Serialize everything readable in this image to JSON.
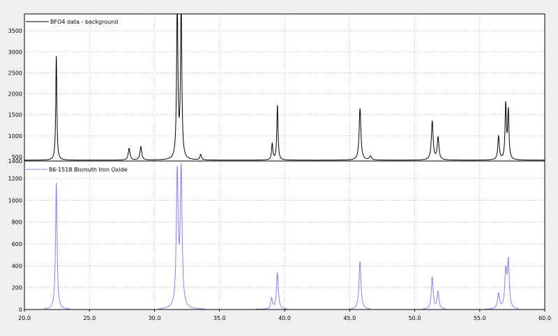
{
  "colors": {
    "background": "#f0f0f0",
    "plot_background": "#ffffff",
    "axis": "#000000",
    "grid": "#b4b4b4",
    "series_top": "#000000",
    "series_bottom": "#8080ff",
    "legend_bottom_text": "#8080ff"
  },
  "chart_data": [
    {
      "type": "line",
      "panel": "top",
      "grid": true,
      "legend_position": "top-left",
      "xlim": [
        20.0,
        60.0
      ],
      "ylim": [
        400,
        3900
      ],
      "y_tick_labels": [
        "400",
        "500",
        "1000",
        "1500",
        "2000",
        "2500",
        "3000",
        "3500"
      ],
      "y_tick_values": [
        400,
        500,
        1000,
        1500,
        2000,
        2500,
        3000,
        3500
      ],
      "y_tick_label_display": [
        "1400",
        "500",
        "1000",
        "1500",
        "2000",
        "2500",
        "3000",
        "3500"
      ],
      "series": [
        {
          "name": "BFO4 data - background",
          "color": "#000000",
          "baseline": 420,
          "peaks": [
            {
              "x": 22.45,
              "y": 2480,
              "w": 0.05
            },
            {
              "x": 28.05,
              "y": 280,
              "w": 0.08
            },
            {
              "x": 28.95,
              "y": 320,
              "w": 0.08
            },
            {
              "x": 31.75,
              "y": 3700,
              "w": 0.06
            },
            {
              "x": 32.05,
              "y": 3700,
              "w": 0.06
            },
            {
              "x": 33.55,
              "y": 130,
              "w": 0.07
            },
            {
              "x": 39.05,
              "y": 380,
              "w": 0.06
            },
            {
              "x": 39.45,
              "y": 1300,
              "w": 0.055
            },
            {
              "x": 45.8,
              "y": 1230,
              "w": 0.08
            },
            {
              "x": 46.6,
              "y": 90,
              "w": 0.1
            },
            {
              "x": 51.35,
              "y": 920,
              "w": 0.08
            },
            {
              "x": 51.8,
              "y": 530,
              "w": 0.08
            },
            {
              "x": 56.45,
              "y": 560,
              "w": 0.07
            },
            {
              "x": 57.0,
              "y": 1300,
              "w": 0.06
            },
            {
              "x": 57.2,
              "y": 1150,
              "w": 0.06
            }
          ]
        }
      ]
    },
    {
      "type": "line",
      "panel": "bottom",
      "grid": true,
      "legend_position": "top-left",
      "xlim": [
        20.0,
        60.0
      ],
      "ylim": [
        0,
        1360
      ],
      "y_tick_labels": [
        "0",
        "200",
        "400",
        "600",
        "800",
        "1000",
        "1200"
      ],
      "y_tick_values": [
        0,
        200,
        400,
        600,
        800,
        1000,
        1200
      ],
      "x_tick_labels": [
        "20.0",
        "25.0",
        "30.0",
        "35.0",
        "40.0",
        "45.0",
        "50.0",
        "55.0",
        "60.0"
      ],
      "x_tick_values": [
        20,
        25,
        30,
        35,
        40,
        45,
        50,
        55,
        60
      ],
      "series": [
        {
          "name": "86-1518 Bismuth Iron Oxide",
          "color": "#8080ff",
          "baseline": 0,
          "segments": [
            [
              21.5,
              23.5
            ],
            [
              30.3,
              33.9
            ],
            [
              37.8,
              40.2
            ],
            [
              45.0,
              46.6
            ],
            [
              50.6,
              52.4
            ],
            [
              55.4,
              58.0
            ]
          ],
          "peaks": [
            {
              "x": 22.45,
              "y": 1160,
              "w": 0.07
            },
            {
              "x": 31.75,
              "y": 1220,
              "w": 0.085
            },
            {
              "x": 32.05,
              "y": 1250,
              "w": 0.085
            },
            {
              "x": 37.75,
              "y": 10,
              "w": 0.08
            },
            {
              "x": 39.0,
              "y": 100,
              "w": 0.08
            },
            {
              "x": 39.45,
              "y": 330,
              "w": 0.085
            },
            {
              "x": 45.8,
              "y": 440,
              "w": 0.09
            },
            {
              "x": 51.35,
              "y": 290,
              "w": 0.085
            },
            {
              "x": 51.8,
              "y": 160,
              "w": 0.085
            },
            {
              "x": 56.45,
              "y": 140,
              "w": 0.09
            },
            {
              "x": 57.0,
              "y": 330,
              "w": 0.09
            },
            {
              "x": 57.2,
              "y": 420,
              "w": 0.085
            }
          ]
        }
      ]
    }
  ]
}
